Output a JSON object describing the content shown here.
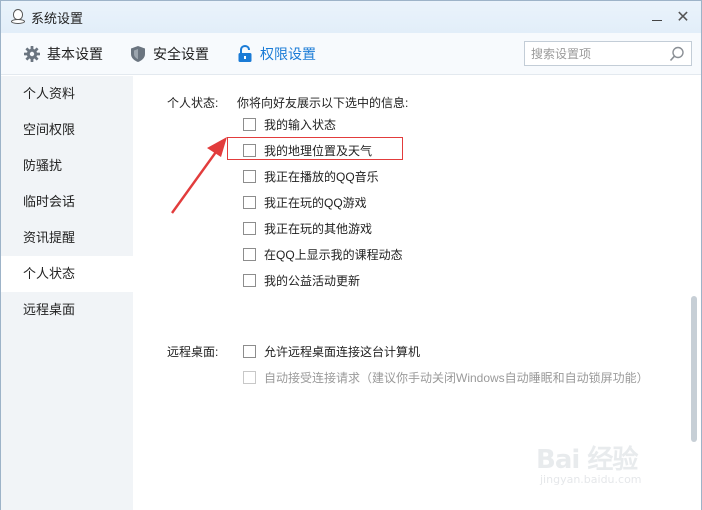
{
  "window": {
    "title": "系统设置"
  },
  "toolbar": {
    "tabs": [
      {
        "label": "基本设置"
      },
      {
        "label": "安全设置"
      },
      {
        "label": "权限设置"
      }
    ],
    "search_placeholder": "搜索设置项",
    "active_color": "#1a7bd6"
  },
  "sidebar": {
    "items": [
      {
        "label": "个人资料"
      },
      {
        "label": "空间权限"
      },
      {
        "label": "防骚扰"
      },
      {
        "label": "临时会话"
      },
      {
        "label": "资讯提醒"
      },
      {
        "label": "个人状态"
      },
      {
        "label": "远程桌面"
      }
    ],
    "active": "个人状态"
  },
  "personal_status": {
    "label": "个人状态:",
    "description": "你将向好友展示以下选中的信息:",
    "options": [
      {
        "label": "我的输入状态",
        "checked": false
      },
      {
        "label": "我的地理位置及天气",
        "checked": false
      },
      {
        "label": "我正在播放的QQ音乐",
        "checked": false
      },
      {
        "label": "我正在玩的QQ游戏",
        "checked": false
      },
      {
        "label": "我正在玩的其他游戏",
        "checked": false
      },
      {
        "label": "在QQ上显示我的课程动态",
        "checked": false
      },
      {
        "label": "我的公益活动更新",
        "checked": false
      }
    ]
  },
  "remote_desktop": {
    "label": "远程桌面:",
    "options": [
      {
        "label": "允许远程桌面连接这台计算机",
        "checked": false,
        "disabled": false
      },
      {
        "label": "自动接受连接请求（建议你手动关闭Windows自动睡眠和自动锁屏功能）",
        "checked": false,
        "disabled": true
      }
    ]
  },
  "annotation": {
    "highlight_color": "#e23c3c"
  },
  "watermark": {
    "main": "Bai 经验",
    "sub": "jingyan.baidu.com"
  }
}
